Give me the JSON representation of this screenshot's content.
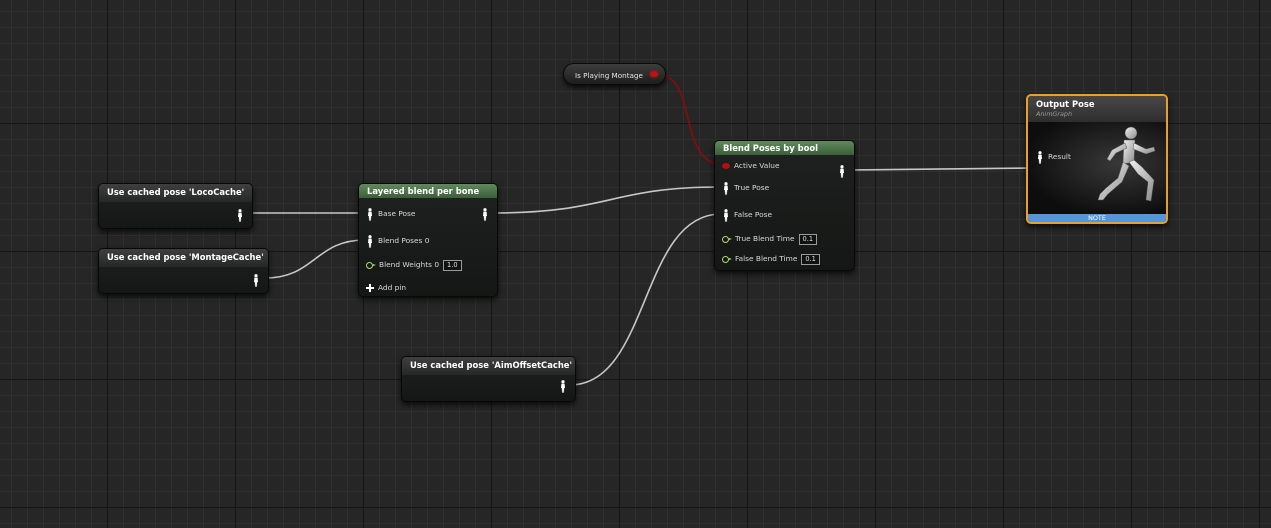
{
  "colors": {
    "pose_wire": "#c7c7c7",
    "bool_wire": "#8c0a0a",
    "exec_pin": "#a9de6d",
    "bool_pin": "#b01010",
    "output_border": "#e8a028",
    "note_bar": "#5795d9",
    "node_header_green": "#4e7a4b"
  },
  "nodes": {
    "loco": {
      "title": "Use cached pose 'LocoCache'",
      "pin_icon": "person-icon"
    },
    "montage": {
      "title": "Use cached pose 'MontageCache'",
      "pin_icon": "person-icon"
    },
    "aim": {
      "title": "Use cached pose 'AimOffsetCache'",
      "pin_icon": "person-icon"
    },
    "is_playing": {
      "label": "Is Playing Montage",
      "pin_icon": "bool-pin-icon"
    },
    "layered": {
      "title": "Layered blend per bone",
      "base_pose": "Base Pose",
      "blend_poses": "Blend Poses 0",
      "blend_weights": "Blend Weights 0",
      "blend_weights_value": "1.0",
      "add_pin": "Add pin"
    },
    "blend_bool": {
      "title": "Blend Poses by bool",
      "active_value": "Active Value",
      "true_pose": "True Pose",
      "false_pose": "False Pose",
      "true_blend_time": "True Blend Time",
      "true_blend_time_value": "0.1",
      "false_blend_time": "False Blend Time",
      "false_blend_time_value": "0.1"
    },
    "output": {
      "title": "Output Pose",
      "subtitle": "AnimGraph",
      "result": "Result",
      "note": "NOTE",
      "preview_icon": "mannequin-running-icon"
    }
  }
}
